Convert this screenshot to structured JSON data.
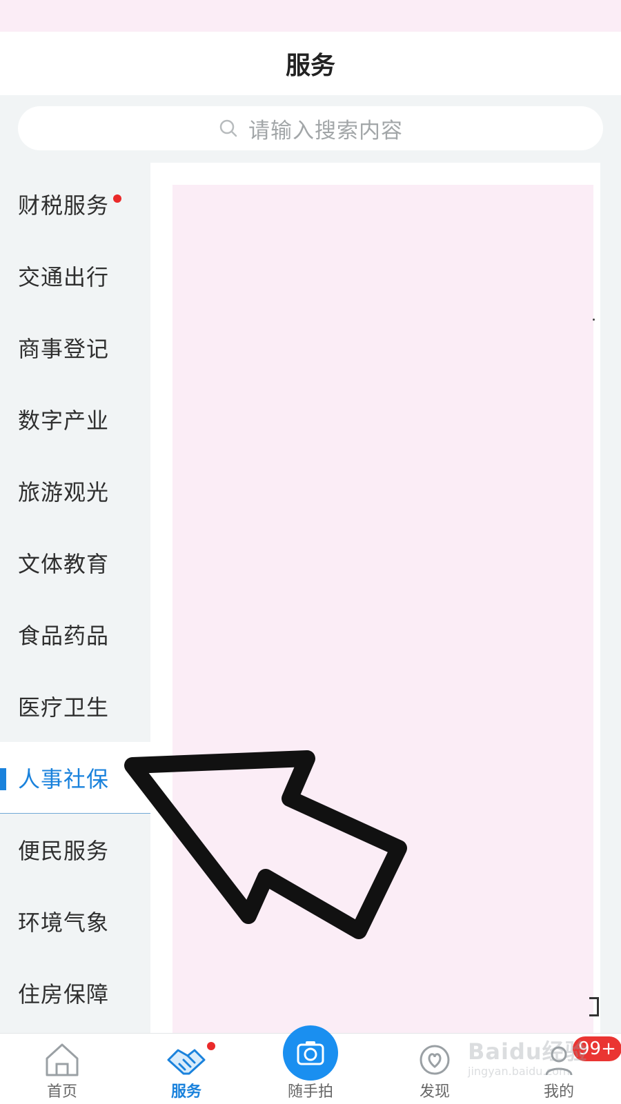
{
  "header": {
    "title": "服务"
  },
  "search": {
    "placeholder": "请输入搜索内容",
    "icon": "search-icon"
  },
  "sidebar": {
    "active_index": 8,
    "items": [
      {
        "label": "财税服务",
        "has_dot": true
      },
      {
        "label": "交通出行"
      },
      {
        "label": "商事登记"
      },
      {
        "label": "数字产业"
      },
      {
        "label": "旅游观光"
      },
      {
        "label": "文体教育"
      },
      {
        "label": "食品药品"
      },
      {
        "label": "医疗卫生"
      },
      {
        "label": "人事社保"
      },
      {
        "label": "便民服务"
      },
      {
        "label": "环境气象"
      },
      {
        "label": "住房保障"
      }
    ]
  },
  "tabbar": {
    "tabs": [
      {
        "label": "首页",
        "icon": "home-icon"
      },
      {
        "label": "服务",
        "icon": "handshake-icon",
        "active": true,
        "has_dot": true
      },
      {
        "label": "随手拍",
        "icon": "camera-icon"
      },
      {
        "label": "发现",
        "icon": "discover-icon"
      },
      {
        "label": "我的",
        "icon": "profile-icon",
        "badge": "99+"
      }
    ]
  },
  "watermark": {
    "logo": "Baidu经验",
    "url": "jingyan.baidu.com"
  },
  "colors": {
    "accent": "#1a82dc",
    "badge": "#ea3532",
    "sidebar_bg": "#f1f4f5",
    "placeholder_bg": "#fbedf6"
  }
}
